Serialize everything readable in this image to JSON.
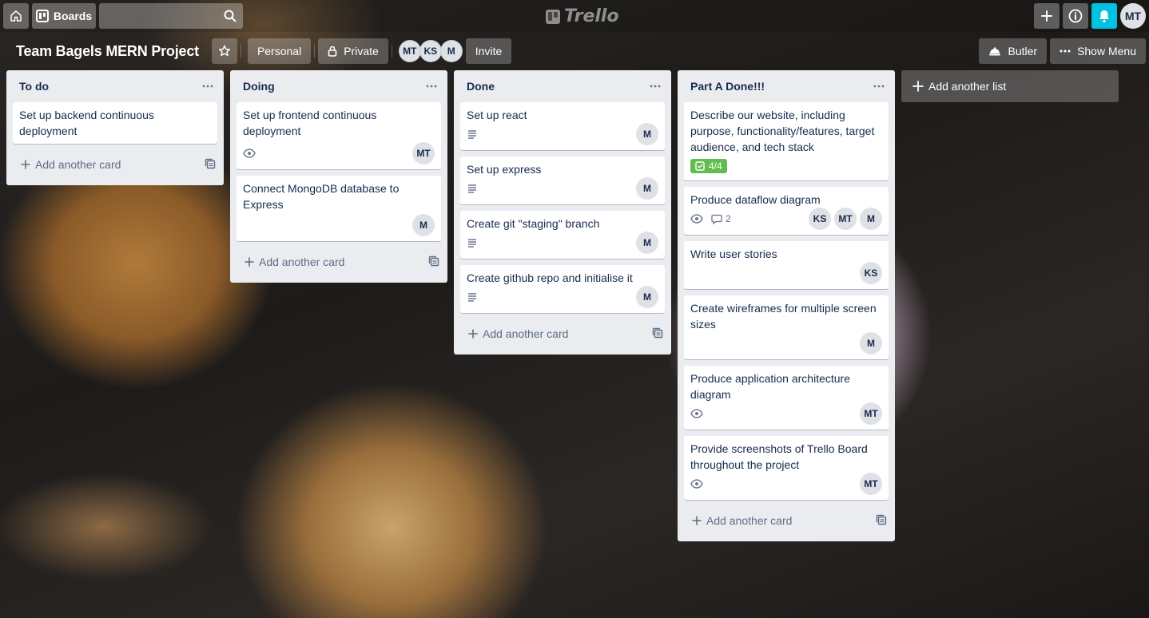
{
  "header": {
    "boards_label": "Boards",
    "search_placeholder": "",
    "logo_text": "Trello",
    "user_initials": "MT"
  },
  "board": {
    "title": "Team Bagels MERN Project",
    "personal_label": "Personal",
    "private_label": "Private",
    "members": [
      "MT",
      "KS",
      "M"
    ],
    "invite_label": "Invite",
    "butler_label": "Butler",
    "show_menu_label": "Show Menu"
  },
  "colors": {
    "accent_bell": "#00c2e0",
    "checklist_green": "#61bd4f",
    "list_bg": "#ebecf0"
  },
  "lists": [
    {
      "title": "To do",
      "cards": [
        {
          "title": "Set up backend continuous deployment",
          "members": [],
          "has_description": false,
          "watching": false
        }
      ],
      "add_card_label": "Add another card"
    },
    {
      "title": "Doing",
      "cards": [
        {
          "title": "Set up frontend continuous deployment",
          "members": [
            "MT"
          ],
          "has_description": false,
          "watching": true
        },
        {
          "title": "Connect MongoDB database to Express",
          "members": [
            "M"
          ],
          "has_description": false,
          "watching": false
        }
      ],
      "add_card_label": "Add another card"
    },
    {
      "title": "Done",
      "cards": [
        {
          "title": "Set up react",
          "members": [
            "M"
          ],
          "has_description": true,
          "watching": false
        },
        {
          "title": "Set up express",
          "members": [
            "M"
          ],
          "has_description": true,
          "watching": false
        },
        {
          "title": "Create git \"staging\" branch",
          "members": [
            "M"
          ],
          "has_description": true,
          "watching": false
        },
        {
          "title": "Create github repo and initialise it",
          "members": [
            "M"
          ],
          "has_description": true,
          "watching": false
        }
      ],
      "add_card_label": "Add another card"
    },
    {
      "title": "Part A Done!!!",
      "cards": [
        {
          "title": "Describe our website, including purpose, functionality/features, target audience, and tech stack",
          "members": [],
          "checklist": "4/4",
          "has_description": false,
          "watching": false
        },
        {
          "title": "Produce dataflow diagram",
          "members": [
            "KS",
            "MT",
            "M"
          ],
          "has_description": false,
          "watching": true,
          "comments": "2"
        },
        {
          "title": "Write user stories",
          "members": [
            "KS"
          ],
          "has_description": false,
          "watching": false
        },
        {
          "title": "Create wireframes for multiple screen sizes",
          "members": [
            "M"
          ],
          "has_description": false,
          "watching": false
        },
        {
          "title": "Produce application architecture diagram",
          "members": [
            "MT"
          ],
          "has_description": false,
          "watching": true
        },
        {
          "title": "Provide screenshots of Trello Board throughout the project",
          "members": [
            "MT"
          ],
          "has_description": false,
          "watching": true
        }
      ],
      "add_card_label": "Add another card"
    }
  ],
  "add_list_label": "Add another list",
  "icons": [
    "home-icon",
    "boards-icon",
    "search-icon",
    "plus-icon",
    "info-icon",
    "bell-icon",
    "star-icon",
    "lock-icon",
    "butler-icon",
    "more-icon",
    "description-icon",
    "eye-icon",
    "comment-icon",
    "checklist-icon",
    "template-icon"
  ]
}
